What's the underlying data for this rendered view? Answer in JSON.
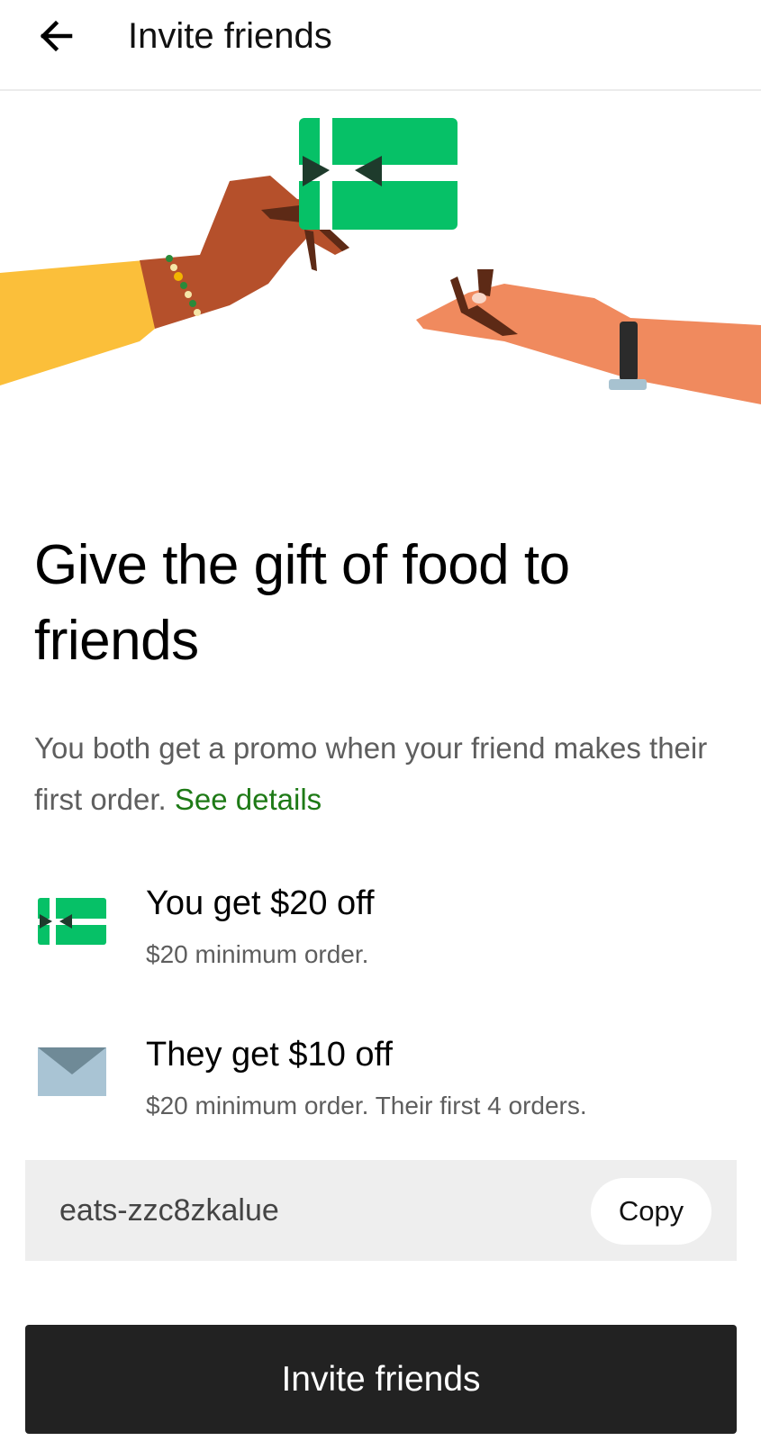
{
  "header": {
    "back_icon": "arrow-left-icon",
    "title": "Invite friends"
  },
  "hero": {
    "illustration": "hands-passing-gift-card",
    "headline": "Give the gift of food to friends",
    "description": "You both get a promo when your friend makes their first order.",
    "see_details": "See details"
  },
  "rewards": [
    {
      "icon": "gift-card-icon",
      "title": "You get $20 off",
      "subtitle": "$20 minimum order."
    },
    {
      "icon": "envelope-icon",
      "title": "They get $10 off",
      "subtitle": "$20 minimum order. Their first 4 orders."
    }
  ],
  "invite_code": {
    "code": "eats-zzc8zkalue",
    "copy_label": "Copy"
  },
  "cta": {
    "label": "Invite friends"
  },
  "colors": {
    "accent_green": "#06c167",
    "link_green": "#1e7a16",
    "cta_background": "#222222",
    "code_background": "#eeeeee"
  }
}
